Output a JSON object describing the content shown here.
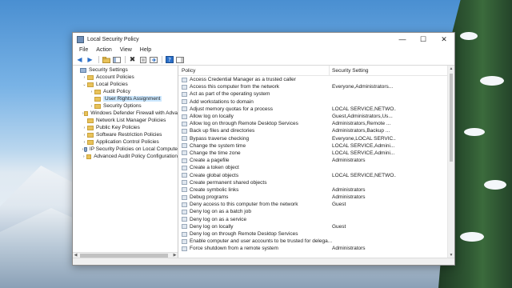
{
  "window": {
    "title": "Local Security Policy",
    "controls": {
      "minimize": "—",
      "maximize": "☐",
      "close": "✕"
    }
  },
  "menu": [
    "File",
    "Action",
    "View",
    "Help"
  ],
  "tree": [
    {
      "label": "Security Settings",
      "level": 0,
      "expander": "",
      "icon": "pc-icon"
    },
    {
      "label": "Account Policies",
      "level": 1,
      "expander": "›",
      "icon": "folder-icon"
    },
    {
      "label": "Local Policies",
      "level": 1,
      "expander": "⌄",
      "icon": "folder-icon"
    },
    {
      "label": "Audit Policy",
      "level": 2,
      "expander": "›",
      "icon": "folder-icon"
    },
    {
      "label": "User Rights Assignment",
      "level": 2,
      "expander": "",
      "icon": "folder-icon",
      "selected": true
    },
    {
      "label": "Security Options",
      "level": 2,
      "expander": "›",
      "icon": "folder-icon"
    },
    {
      "label": "Windows Defender Firewall with Adva",
      "level": 1,
      "expander": "›",
      "icon": "folder-icon"
    },
    {
      "label": "Network List Manager Policies",
      "level": 1,
      "expander": "",
      "icon": "folder-icon"
    },
    {
      "label": "Public Key Policies",
      "level": 1,
      "expander": "›",
      "icon": "folder-icon"
    },
    {
      "label": "Software Restriction Policies",
      "level": 1,
      "expander": "›",
      "icon": "folder-icon"
    },
    {
      "label": "Application Control Policies",
      "level": 1,
      "expander": "›",
      "icon": "folder-icon"
    },
    {
      "label": "IP Security Policies on Local Compute",
      "level": 1,
      "expander": "›",
      "icon": "shield-icon"
    },
    {
      "label": "Advanced Audit Policy Configuration",
      "level": 1,
      "expander": "›",
      "icon": "folder-icon"
    }
  ],
  "list": {
    "columns": [
      "Policy",
      "Security Setting"
    ],
    "rows": [
      {
        "policy": "Access Credential Manager as a trusted caller",
        "setting": ""
      },
      {
        "policy": "Access this computer from the network",
        "setting": "Everyone,Administrators..."
      },
      {
        "policy": "Act as part of the operating system",
        "setting": ""
      },
      {
        "policy": "Add workstations to domain",
        "setting": ""
      },
      {
        "policy": "Adjust memory quotas for a process",
        "setting": "LOCAL SERVICE,NETWO..."
      },
      {
        "policy": "Allow log on locally",
        "setting": "Guest,Administrators,Us..."
      },
      {
        "policy": "Allow log on through Remote Desktop Services",
        "setting": "Administrators,Remote ..."
      },
      {
        "policy": "Back up files and directories",
        "setting": "Administrators,Backup ..."
      },
      {
        "policy": "Bypass traverse checking",
        "setting": "Everyone,LOCAL SERVIC..."
      },
      {
        "policy": "Change the system time",
        "setting": "LOCAL SERVICE,Admini..."
      },
      {
        "policy": "Change the time zone",
        "setting": "LOCAL SERVICE,Admini..."
      },
      {
        "policy": "Create a pagefile",
        "setting": "Administrators"
      },
      {
        "policy": "Create a token object",
        "setting": ""
      },
      {
        "policy": "Create global objects",
        "setting": "LOCAL SERVICE,NETWO..."
      },
      {
        "policy": "Create permanent shared objects",
        "setting": ""
      },
      {
        "policy": "Create symbolic links",
        "setting": "Administrators"
      },
      {
        "policy": "Debug programs",
        "setting": "Administrators"
      },
      {
        "policy": "Deny access to this computer from the network",
        "setting": "Guest"
      },
      {
        "policy": "Deny log on as a batch job",
        "setting": ""
      },
      {
        "policy": "Deny log on as a service",
        "setting": ""
      },
      {
        "policy": "Deny log on locally",
        "setting": "Guest"
      },
      {
        "policy": "Deny log on through Remote Desktop Services",
        "setting": ""
      },
      {
        "policy": "Enable computer and user accounts to be trusted for delega...",
        "setting": ""
      },
      {
        "policy": "Force shutdown from a remote system",
        "setting": "Administrators"
      }
    ]
  }
}
